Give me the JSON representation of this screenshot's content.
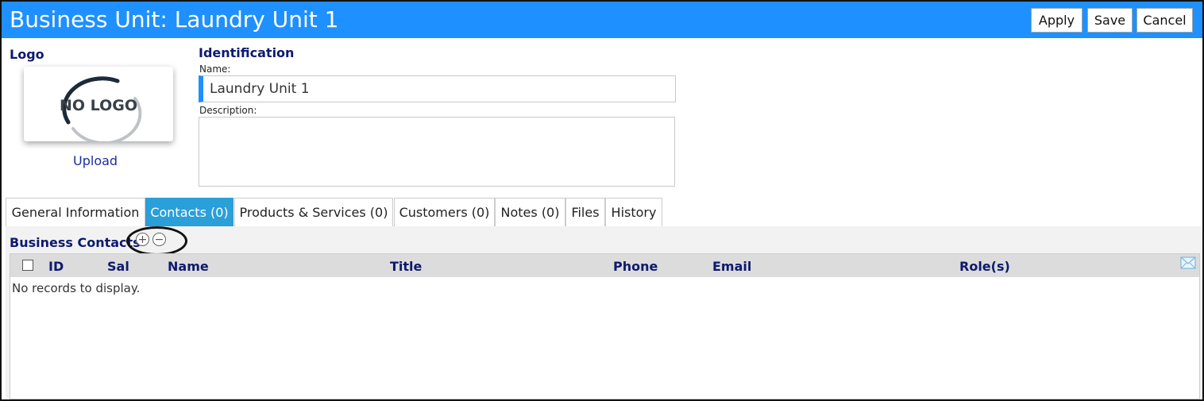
{
  "header": {
    "title": "Business Unit: Laundry Unit 1",
    "buttons": {
      "apply": "Apply",
      "save": "Save",
      "cancel": "Cancel"
    },
    "accent_color": "#1e90ff"
  },
  "logo": {
    "heading": "Logo",
    "placeholder_text": "NO LOGO",
    "upload_label": "Upload"
  },
  "identification": {
    "heading": "Identification",
    "name_label": "Name:",
    "name_value": "Laundry Unit 1",
    "description_label": "Description:",
    "description_value": ""
  },
  "tabs": [
    {
      "label": "General Information",
      "active": false
    },
    {
      "label": "Contacts (0)",
      "active": true
    },
    {
      "label": "Products & Services (0)",
      "active": false
    },
    {
      "label": "Customers (0)",
      "active": false
    },
    {
      "label": "Notes (0)",
      "active": false
    },
    {
      "label": "Files",
      "active": false
    },
    {
      "label": "History",
      "active": false
    }
  ],
  "contacts": {
    "title": "Business Contacts",
    "add_icon": "plus-circle-icon",
    "remove_icon": "minus-circle-icon",
    "columns": [
      "ID",
      "Sal",
      "Name",
      "Title",
      "Phone",
      "Email",
      "Role(s)"
    ],
    "empty_message": "No records to display.",
    "email_icon": "envelope-icon"
  }
}
